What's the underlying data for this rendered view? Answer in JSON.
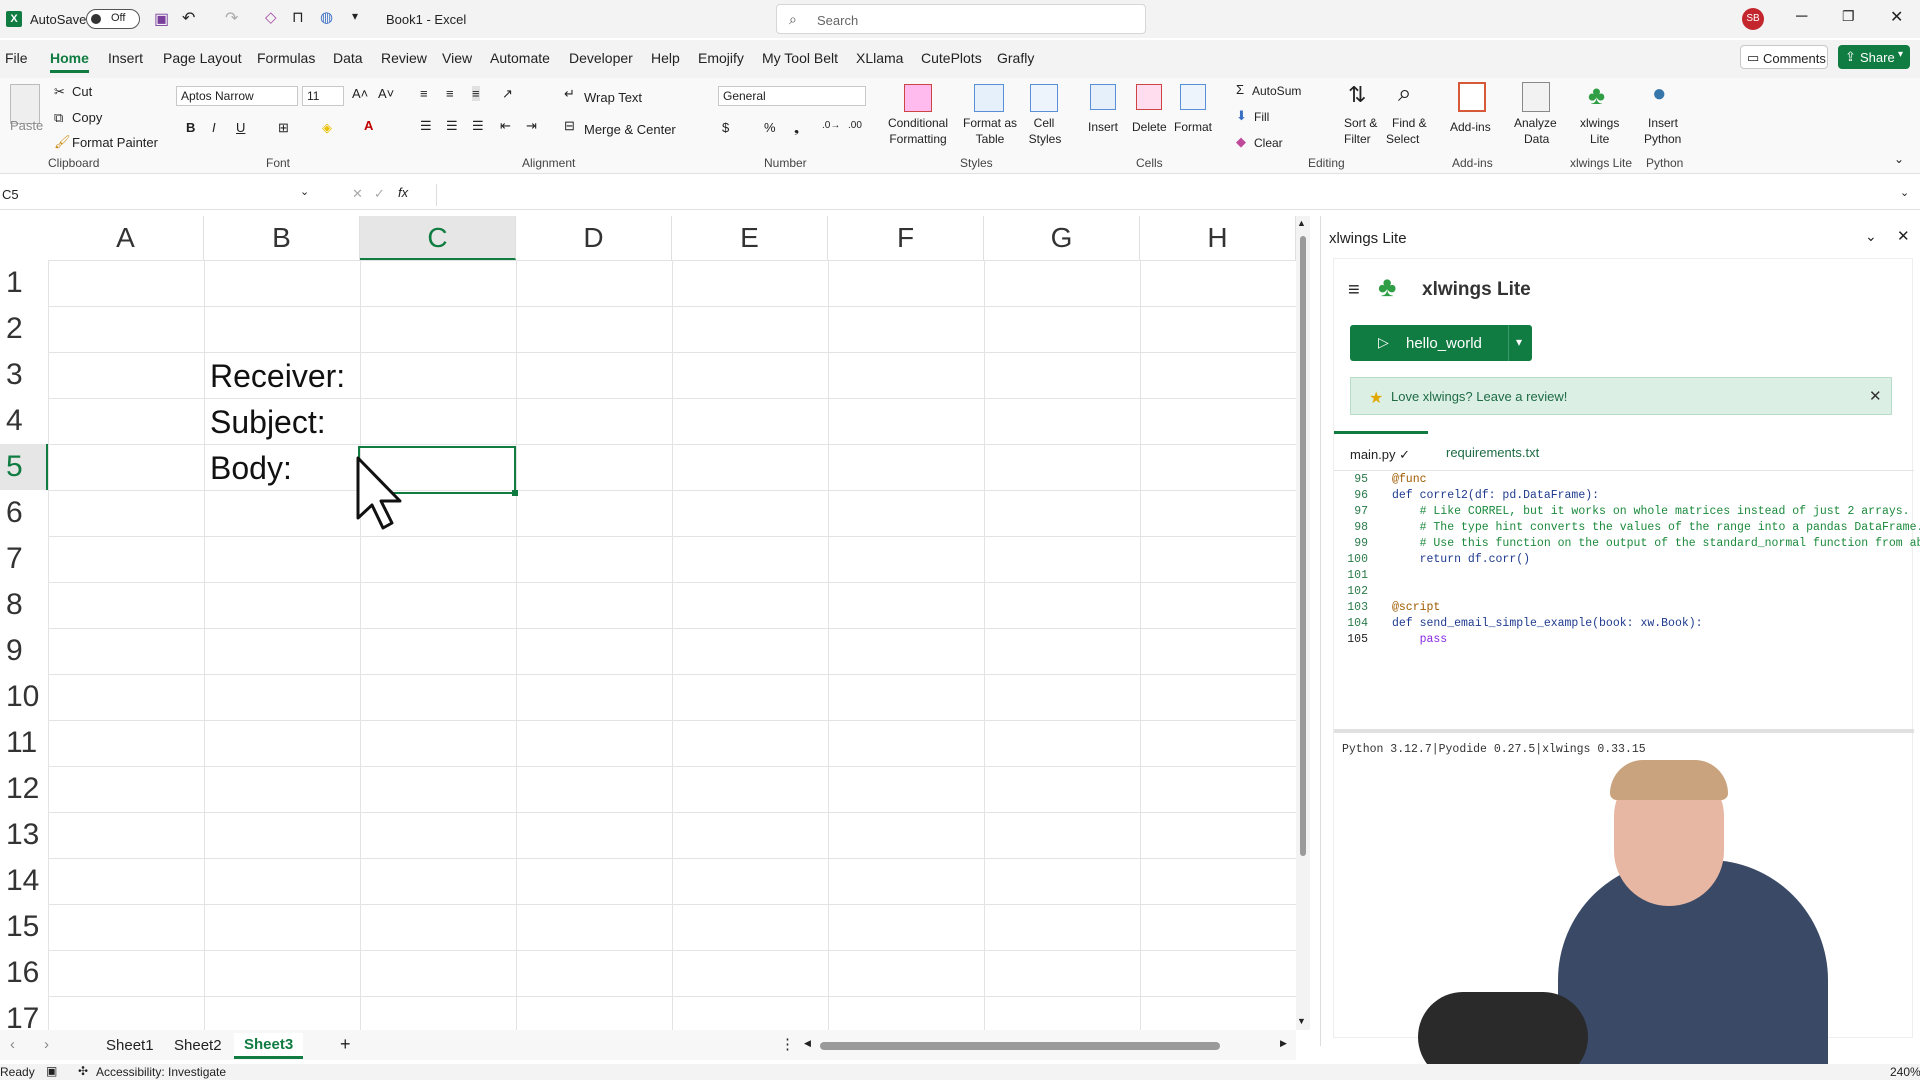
{
  "titlebar": {
    "autosave_label": "AutoSave",
    "autosave_state": "Off",
    "doc_title": "Book1  -  Excel",
    "search_placeholder": "Search",
    "user_initials": "SB"
  },
  "menu": {
    "items": [
      "File",
      "Home",
      "Insert",
      "Page Layout",
      "Formulas",
      "Data",
      "Review",
      "View",
      "Automate",
      "Developer",
      "Help",
      "Emojify",
      "My Tool Belt",
      "XLlama",
      "CutePlots",
      "Grafly"
    ],
    "active": "Home",
    "comments_label": "Comments",
    "share_label": "Share"
  },
  "ribbon": {
    "clipboard": {
      "paste": "Paste",
      "cut": "Cut",
      "copy": "Copy",
      "format_painter": "Format Painter",
      "group": "Clipboard"
    },
    "font": {
      "name": "Aptos Narrow",
      "size": "11",
      "group": "Font"
    },
    "alignment": {
      "wrap": "Wrap Text",
      "merge": "Merge & Center",
      "group": "Alignment"
    },
    "number": {
      "format": "General",
      "group": "Number"
    },
    "styles": {
      "conditional": [
        "Conditional",
        "Formatting"
      ],
      "format_table": [
        "Format as",
        "Table"
      ],
      "cell_styles": [
        "Cell",
        "Styles"
      ],
      "group": "Styles"
    },
    "cells": {
      "insert": "Insert",
      "delete": "Delete",
      "format": "Format",
      "group": "Cells"
    },
    "editing": {
      "autosum": "AutoSum",
      "fill": "Fill",
      "clear": "Clear",
      "sort": [
        "Sort &",
        "Filter"
      ],
      "find": [
        "Find &",
        "Select"
      ],
      "group": "Editing"
    },
    "addins": {
      "label": "Add-ins",
      "analyze": [
        "Analyze",
        "Data"
      ],
      "group": "Add-ins"
    },
    "xlwings": {
      "label": [
        "xlwings",
        "Lite"
      ],
      "group": "xlwings Lite"
    },
    "python": {
      "label": [
        "Insert",
        "Python"
      ],
      "group": "Python"
    }
  },
  "formula_bar": {
    "name_box": "C5",
    "fx": "fx",
    "value": ""
  },
  "sheet": {
    "columns": [
      "A",
      "B",
      "C",
      "D",
      "E",
      "F",
      "G",
      "H"
    ],
    "rows": [
      "1",
      "2",
      "3",
      "4",
      "5",
      "6",
      "7",
      "8",
      "9",
      "10",
      "11",
      "12",
      "13",
      "14",
      "15",
      "16",
      "17"
    ],
    "cells": {
      "B3": "Receiver:",
      "B4": "Subject:",
      "B5": "Body:"
    },
    "selected": "C5",
    "tabs": [
      "Sheet1",
      "Sheet2",
      "Sheet3"
    ],
    "active_tab": "Sheet3"
  },
  "panel": {
    "title": "xlwings Lite",
    "brand": "xlwings Lite",
    "run_button": "hello_world",
    "banner": "Love xlwings? Leave a review!",
    "tabs": [
      "main.py ✓",
      "requirements.txt"
    ],
    "code_lines": [
      {
        "n": "95",
        "t": "@func"
      },
      {
        "n": "96",
        "t": "def correl2(df: pd.DataFrame):"
      },
      {
        "n": "97",
        "t": "    # Like CORREL, but it works on whole matrices instead of just 2 arrays."
      },
      {
        "n": "98",
        "t": "    # The type hint converts the values of the range into a pandas DataFrame."
      },
      {
        "n": "99",
        "t": "    # Use this function on the output of the standard_normal function from ab"
      },
      {
        "n": "100",
        "t": "    return df.corr()"
      },
      {
        "n": "101",
        "t": ""
      },
      {
        "n": "102",
        "t": ""
      },
      {
        "n": "103",
        "t": "@script"
      },
      {
        "n": "104",
        "t": "def send_email_simple_example(book: xw.Book):"
      },
      {
        "n": "105",
        "t": "    pass"
      }
    ],
    "console": "Python 3.12.7|Pyodide 0.27.5|xlwings 0.33.15"
  },
  "status": {
    "ready": "Ready",
    "accessibility": "Accessibility: Investigate",
    "zoom": "240%"
  },
  "colors": {
    "excel_green": "#107c41",
    "accent": "#217346",
    "banner_bg": "#dcefe5"
  }
}
